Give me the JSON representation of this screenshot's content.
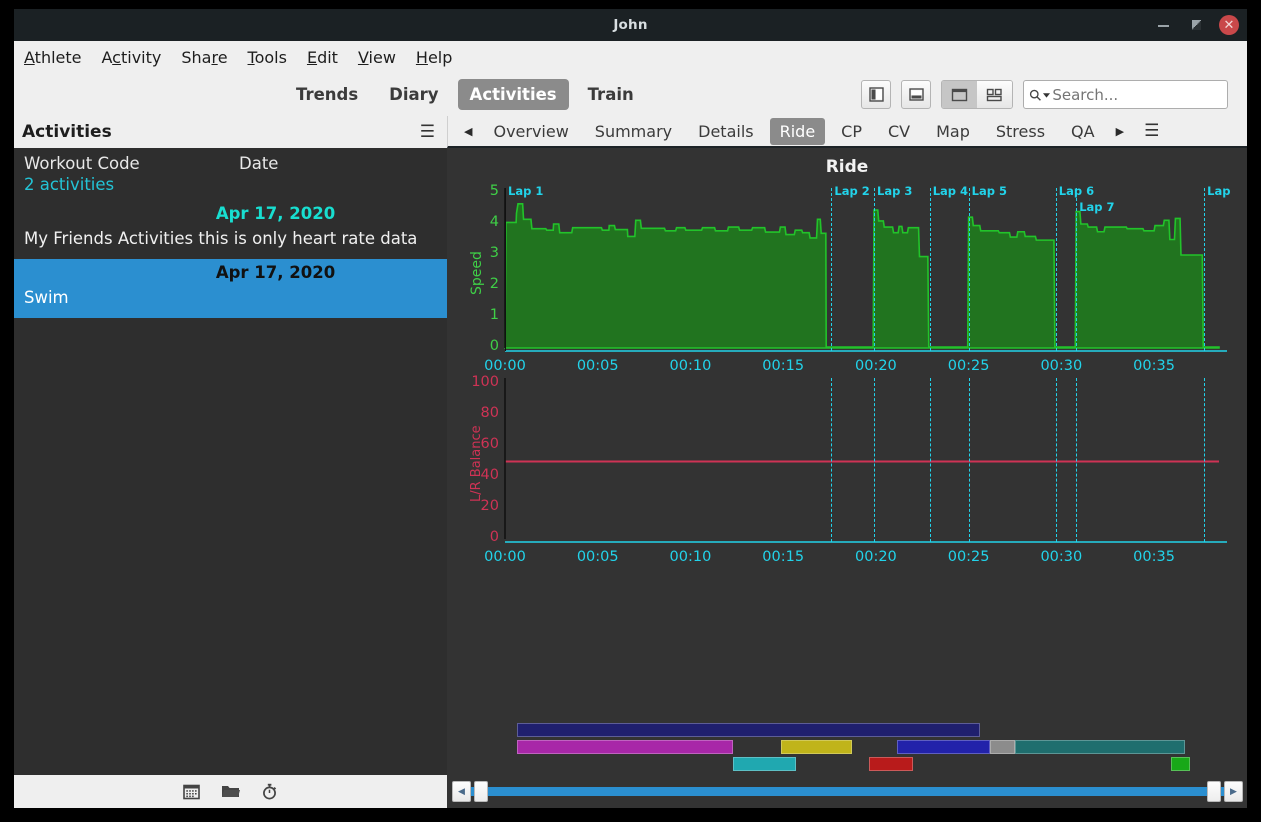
{
  "window": {
    "title": "John",
    "minimize_label": "–",
    "maximize_label": "",
    "close_label": "✕"
  },
  "menubar": [
    {
      "pre": "",
      "accel": "A",
      "post": "thlete"
    },
    {
      "pre": "A",
      "accel": "c",
      "post": "tivity"
    },
    {
      "pre": "Sha",
      "accel": "r",
      "post": "e"
    },
    {
      "pre": "",
      "accel": "T",
      "post": "ools"
    },
    {
      "pre": "",
      "accel": "E",
      "post": "dit"
    },
    {
      "pre": "",
      "accel": "V",
      "post": "iew"
    },
    {
      "pre": "",
      "accel": "H",
      "post": "elp"
    }
  ],
  "toolbar": {
    "tabs": [
      {
        "label": "Trends",
        "active": false
      },
      {
        "label": "Diary",
        "active": false
      },
      {
        "label": "Activities",
        "active": true
      },
      {
        "label": "Train",
        "active": false
      }
    ],
    "sidebar_toggle_icon": "sidebar-panel-icon",
    "bottom_toggle_icon": "bottom-panel-icon",
    "view_single_icon": "single-view-icon",
    "view_tiled_icon": "tiled-view-icon",
    "search": {
      "placeholder": "Search...",
      "value": "",
      "icon": "search-icon",
      "dropdown_icon": "caret-down-icon"
    }
  },
  "sidebar": {
    "header_title": "Activities",
    "menu_icon": "hamburger-icon",
    "columns": [
      "Workout Code",
      "Date"
    ],
    "count_label": "2 activities",
    "rows": [
      {
        "date": "Apr 17, 2020",
        "name": "My Friends Activities this is only heart rate data",
        "selected": false
      },
      {
        "date": "Apr 17, 2020",
        "name": "Swim",
        "selected": true
      }
    ],
    "footer_icons": [
      "calendar-icon",
      "folder-icon",
      "stopwatch-icon"
    ]
  },
  "tabbar": {
    "prev_icon": "chevron-left-icon",
    "next_icon": "chevron-right-icon",
    "menu_icon": "hamburger-icon",
    "tabs": [
      {
        "label": "Overview",
        "active": false
      },
      {
        "label": "Summary",
        "active": false
      },
      {
        "label": "Details",
        "active": false
      },
      {
        "label": "Ride",
        "active": true
      },
      {
        "label": "CP",
        "active": false
      },
      {
        "label": "CV",
        "active": false
      },
      {
        "label": "Map",
        "active": false
      },
      {
        "label": "Stress",
        "active": false
      },
      {
        "label": "QA",
        "active": false
      }
    ]
  },
  "colors": {
    "background": "#333333",
    "speed_line": "#22c32a",
    "speed_fill": "#21741f",
    "speed_axis": "#3fcf47",
    "lr_line": "#cf3355",
    "lap_marker": "#22d3ea",
    "tick_text": "#22d3ea",
    "selection": "#2b8fd0",
    "accent_date": "#18ded0"
  },
  "chart_data": [
    {
      "type": "area",
      "title": "Ride",
      "name": "speed-chart",
      "ylabel": "Speed",
      "xlabel": "",
      "ylim": [
        0,
        5
      ],
      "yticks": [
        0,
        1,
        2,
        3,
        4,
        5
      ],
      "xticks": [
        "00:00",
        "00:05",
        "00:10",
        "00:15",
        "00:20",
        "00:25",
        "00:30",
        "00:35"
      ],
      "xtick_minutes": [
        0,
        5,
        10,
        15,
        20,
        25,
        30,
        35
      ],
      "xlim_minutes": [
        0,
        38.5
      ],
      "grid": false,
      "series_name": "Speed",
      "laps": [
        {
          "label": "Lap 1",
          "minute": 0.0,
          "row": 0
        },
        {
          "label": "Lap 2",
          "minute": 17.6,
          "row": 0
        },
        {
          "label": "Lap 3",
          "minute": 19.9,
          "row": 0
        },
        {
          "label": "Lap 4",
          "minute": 22.9,
          "row": 0
        },
        {
          "label": "Lap 5",
          "minute": 25.0,
          "row": 0
        },
        {
          "label": "Lap 6",
          "minute": 29.7,
          "row": 0
        },
        {
          "label": "Lap 7",
          "minute": 30.8,
          "row": 1
        },
        {
          "label": "Lap",
          "minute": 37.7,
          "row": 0
        }
      ],
      "points": [
        [
          0.0,
          0.0
        ],
        [
          0.05,
          4.05
        ],
        [
          0.6,
          4.05
        ],
        [
          0.62,
          4.35
        ],
        [
          0.7,
          4.65
        ],
        [
          0.95,
          4.65
        ],
        [
          1.0,
          4.15
        ],
        [
          1.4,
          4.15
        ],
        [
          1.45,
          3.85
        ],
        [
          2.2,
          3.85
        ],
        [
          2.25,
          3.8
        ],
        [
          2.6,
          3.8
        ],
        [
          2.62,
          4.0
        ],
        [
          2.9,
          4.0
        ],
        [
          2.95,
          3.72
        ],
        [
          3.6,
          3.72
        ],
        [
          3.65,
          3.88
        ],
        [
          5.2,
          3.88
        ],
        [
          5.25,
          3.8
        ],
        [
          5.6,
          3.8
        ],
        [
          5.62,
          3.95
        ],
        [
          5.9,
          3.95
        ],
        [
          5.95,
          3.82
        ],
        [
          6.6,
          3.82
        ],
        [
          6.62,
          3.6
        ],
        [
          7.0,
          3.6
        ],
        [
          7.05,
          4.12
        ],
        [
          7.3,
          4.12
        ],
        [
          7.35,
          3.86
        ],
        [
          8.6,
          3.86
        ],
        [
          8.65,
          3.78
        ],
        [
          9.2,
          3.78
        ],
        [
          9.25,
          3.88
        ],
        [
          9.7,
          3.88
        ],
        [
          9.75,
          3.8
        ],
        [
          10.6,
          3.8
        ],
        [
          10.65,
          3.88
        ],
        [
          11.3,
          3.88
        ],
        [
          11.35,
          3.78
        ],
        [
          12.0,
          3.78
        ],
        [
          12.05,
          3.9
        ],
        [
          12.6,
          3.9
        ],
        [
          12.65,
          3.8
        ],
        [
          13.3,
          3.8
        ],
        [
          13.35,
          3.88
        ],
        [
          14.0,
          3.88
        ],
        [
          14.05,
          3.74
        ],
        [
          14.8,
          3.74
        ],
        [
          14.85,
          3.9
        ],
        [
          15.1,
          3.9
        ],
        [
          15.15,
          3.66
        ],
        [
          15.6,
          3.66
        ],
        [
          15.65,
          3.8
        ],
        [
          16.0,
          3.8
        ],
        [
          16.05,
          3.72
        ],
        [
          16.4,
          3.72
        ],
        [
          16.45,
          3.55
        ],
        [
          16.8,
          3.55
        ],
        [
          16.85,
          4.15
        ],
        [
          17.0,
          4.15
        ],
        [
          17.05,
          3.7
        ],
        [
          17.3,
          3.7
        ],
        [
          17.32,
          0.03
        ],
        [
          19.85,
          0.03
        ],
        [
          19.9,
          4.45
        ],
        [
          20.1,
          4.45
        ],
        [
          20.15,
          4.1
        ],
        [
          20.4,
          4.1
        ],
        [
          20.45,
          3.9
        ],
        [
          20.9,
          3.9
        ],
        [
          20.95,
          3.72
        ],
        [
          21.2,
          3.72
        ],
        [
          21.25,
          3.92
        ],
        [
          21.4,
          3.92
        ],
        [
          21.45,
          3.72
        ],
        [
          21.7,
          3.72
        ],
        [
          21.75,
          3.88
        ],
        [
          22.3,
          3.88
        ],
        [
          22.35,
          2.95
        ],
        [
          22.8,
          2.95
        ],
        [
          22.85,
          0.03
        ],
        [
          24.95,
          0.03
        ],
        [
          25.0,
          4.22
        ],
        [
          25.2,
          4.22
        ],
        [
          25.25,
          3.95
        ],
        [
          25.6,
          3.95
        ],
        [
          25.65,
          3.78
        ],
        [
          26.6,
          3.78
        ],
        [
          26.65,
          3.72
        ],
        [
          27.2,
          3.72
        ],
        [
          27.25,
          3.58
        ],
        [
          27.6,
          3.58
        ],
        [
          27.65,
          3.75
        ],
        [
          28.0,
          3.75
        ],
        [
          28.05,
          3.6
        ],
        [
          28.6,
          3.6
        ],
        [
          28.65,
          3.48
        ],
        [
          29.6,
          3.48
        ],
        [
          29.65,
          0.03
        ],
        [
          30.75,
          0.03
        ],
        [
          30.8,
          4.4
        ],
        [
          31.0,
          4.4
        ],
        [
          31.05,
          4.0
        ],
        [
          31.4,
          4.0
        ],
        [
          31.45,
          3.9
        ],
        [
          31.9,
          3.9
        ],
        [
          31.95,
          3.75
        ],
        [
          32.3,
          3.75
        ],
        [
          32.35,
          3.9
        ],
        [
          33.5,
          3.9
        ],
        [
          33.55,
          3.85
        ],
        [
          34.4,
          3.85
        ],
        [
          34.45,
          3.78
        ],
        [
          35.0,
          3.78
        ],
        [
          35.05,
          3.95
        ],
        [
          35.5,
          3.95
        ],
        [
          35.55,
          4.12
        ],
        [
          35.8,
          4.12
        ],
        [
          35.85,
          3.5
        ],
        [
          36.1,
          3.5
        ],
        [
          36.15,
          4.18
        ],
        [
          36.4,
          4.18
        ],
        [
          36.45,
          3.0
        ],
        [
          37.6,
          3.0
        ],
        [
          37.65,
          0.03
        ],
        [
          38.5,
          0.03
        ]
      ]
    },
    {
      "type": "line",
      "name": "lr-balance-chart",
      "ylabel": "L/R Balance",
      "xlabel": "",
      "ylim": [
        0,
        100
      ],
      "yticks": [
        0,
        20,
        40,
        60,
        80,
        100
      ],
      "xticks": [
        "00:00",
        "00:05",
        "00:10",
        "00:15",
        "00:20",
        "00:25",
        "00:30",
        "00:35"
      ],
      "xtick_minutes": [
        0,
        5,
        10,
        15,
        20,
        25,
        30,
        35
      ],
      "xlim_minutes": [
        0,
        38.5
      ],
      "grid": false,
      "series_name": "L/R Balance",
      "constant_value": 50,
      "laps": [
        {
          "minute": 17.6
        },
        {
          "minute": 19.9
        },
        {
          "minute": 22.9
        },
        {
          "minute": 25.0
        },
        {
          "minute": 29.7
        },
        {
          "minute": 30.8
        },
        {
          "minute": 37.7
        }
      ]
    }
  ],
  "intervals": {
    "rows": [
      [
        {
          "color": "#1f1f6e",
          "start": 0.0,
          "end": 98.0,
          "name": "interval-whole-ride"
        }
      ],
      [
        {
          "color": "#a827a8",
          "start": 0.0,
          "end": 45.8,
          "name": "interval-magenta"
        },
        {
          "color": "#c0b41a",
          "start": 56.0,
          "end": 71.0,
          "name": "interval-yellow"
        },
        {
          "color": "#2222aa",
          "start": 80.5,
          "end": 100.2,
          "name": "interval-blue"
        },
        {
          "color": "#8c8c8c",
          "start": 100.2,
          "end": 105.5,
          "name": "interval-grey"
        },
        {
          "color": "#1f6e6e",
          "start": 105.5,
          "end": 141.5,
          "name": "interval-teal"
        }
      ],
      [
        {
          "color": "#20a8b0",
          "start": 45.8,
          "end": 59.2,
          "name": "interval-cyan"
        },
        {
          "color": "#b81b1b",
          "start": 74.5,
          "end": 84.0,
          "name": "interval-red"
        },
        {
          "color": "#18a818",
          "start": 138.5,
          "end": 142.5,
          "name": "interval-green"
        }
      ]
    ]
  },
  "scrollbar": {
    "left_icon": "chevron-left-icon",
    "right_icon": "chevron-right-icon",
    "position_percent": 0
  }
}
